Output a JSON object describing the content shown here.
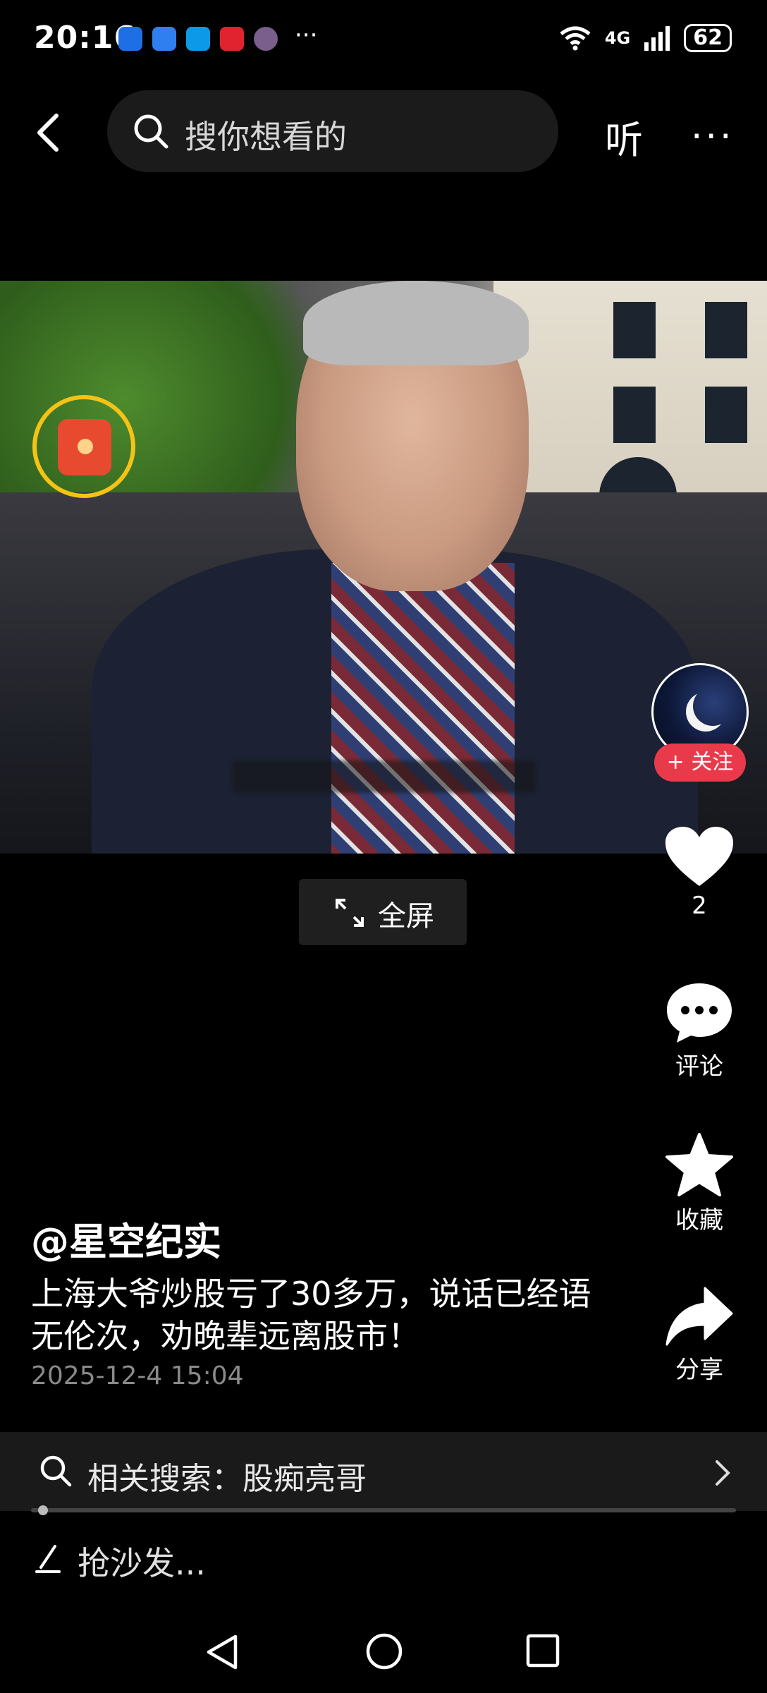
{
  "status_bar": {
    "time": "20:16",
    "more_notifications": "···",
    "network": "4G",
    "battery": "62",
    "app_icon_colors": [
      "#1e6fe6",
      "#2f7ff0",
      "#0c9ae8",
      "#e0232e",
      "#7a5e8c"
    ]
  },
  "top_nav": {
    "back_icon": "chevron-left-icon",
    "search_placeholder": "搜你想看的",
    "listen_label": "听",
    "more_label": "···"
  },
  "video": {
    "fullscreen_label": "全屏"
  },
  "author": {
    "follow_label": "+ 关注"
  },
  "actions": {
    "like_count": "2",
    "comment_label": "评论",
    "favorite_label": "收藏",
    "share_label": "分享"
  },
  "caption": {
    "handle": "@星空纪实",
    "description": "上海大爷炒股亏了30多万，说话已经语无伦次，劝晚辈远离股市！",
    "date": "2025-12-4 15:04"
  },
  "related_search": {
    "text": "相关搜索：股痴亮哥"
  },
  "progress": {
    "played_fraction": 0.01
  },
  "comment_bar": {
    "placeholder": "抢沙发..."
  },
  "colors": {
    "follow_red": "#e93a4c",
    "redpack_ring": "#f5c316"
  }
}
